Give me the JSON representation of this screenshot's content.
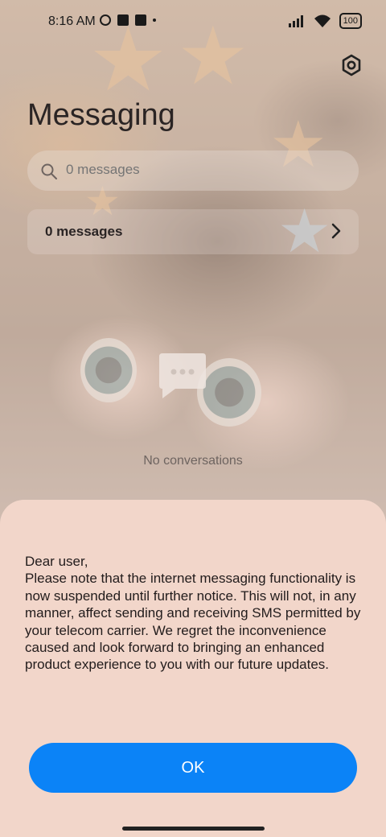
{
  "status_bar": {
    "time": "8:16 AM",
    "battery": "100"
  },
  "header": {
    "title": "Messaging",
    "settings_icon": "gear-icon"
  },
  "search": {
    "placeholder": "0 messages",
    "icon": "search-icon"
  },
  "message_row": {
    "label": "0 messages",
    "icon": "chevron-right-icon"
  },
  "empty_state": {
    "icon": "chat-bubble-icon",
    "text": "No conversations"
  },
  "dialog": {
    "message": "Dear user,\nPlease note that the internet messaging functionality is now suspended until further notice. This will not, in any manner, affect sending and receiving SMS permitted by your telecom carrier. We regret the inconvenience caused and look forward to bringing an enhanced product experience to you with our future updates.",
    "ok_label": "OK"
  },
  "colors": {
    "sheet_background": "#f2d6ca",
    "ok_button": "#0b83f7"
  }
}
